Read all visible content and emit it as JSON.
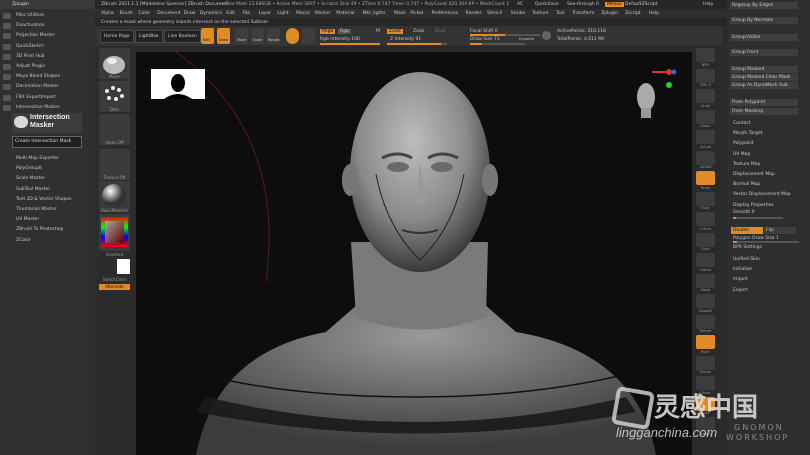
{
  "app": {
    "title": "ZBrush 2021.1.1 [Madeleine Spencer] ZBrush Document"
  },
  "top_info": {
    "status": "• Free Mem 13.686GB • Active Mem 3497 • Scratch Disk 49 • ZTime 0.747 Timer 0.747 • PolyCount 420.364 KP • MeshCount 1",
    "ac": "AC",
    "quicksave": "QuickSave",
    "see_through": "See-through  0",
    "menus_btn": "Menus",
    "default_zscript": "DefaultZScript",
    "help": "Help"
  },
  "menus": [
    "Alpha",
    "Brush",
    "Color",
    "Document",
    "Draw",
    "Dynamics",
    "Edit",
    "File",
    "Layer",
    "Light",
    "Macro",
    "Marker",
    "Material",
    "Mkt_lights",
    "Mask",
    "Picker",
    "Preferences",
    "Render",
    "Stencil",
    "Stroke",
    "Texture",
    "Tool",
    "Transform",
    "Zplugin",
    "Zscript",
    "Help"
  ],
  "tooltip": "Creates a mask where geometry islands intersect on the selected Subtool.",
  "left_panel": {
    "header": "Zplugin",
    "items_top": [
      "Misc Utilities",
      "Deactivation",
      "Projection Master",
      "QuickSketch",
      "3D Print Hub",
      "Adjust Plugin",
      "Maya Blend Shapes",
      "Decimation Master",
      "FBX ExportImport",
      "Intersection Master"
    ],
    "logo_line1": "Intersection",
    "logo_line2": "Masker",
    "create_button": "Create Intersection Mask",
    "items_bottom": [
      "Multi Map Exporter",
      "PolyGroupIt",
      "Scale Master",
      "SubTool Master",
      "Text 3D & Vector Shapes",
      "Thumbnail Master",
      "UV Master",
      "ZBrush To Photoshop",
      "ZColor"
    ]
  },
  "toolbar": {
    "tab_home": "Home Page",
    "tab_lightbox": "LightBox",
    "tab_live": "Live Boolean",
    "edit": "Edit",
    "draw": "Draw",
    "move": "Move",
    "scale": "Scale",
    "rotate": "Rotate",
    "mrgb": "Mrgb",
    "rgb": "Rgb",
    "m": "M",
    "zadd": "Zadd",
    "zsub": "Zsub",
    "zcut": "Zcut",
    "rgb_intensity": "Rgb Intensity 100",
    "z_intensity": "Z Intensity 91",
    "focal_shift": "Focal Shift 0",
    "draw_size": "Draw Size 73",
    "dynamic": "Dynamic",
    "active_points": "ActivePoints: 310,116",
    "total_points": "TotalPoints: 4.611 Mil"
  },
  "shelf": {
    "brush": "Move",
    "stroke": "Dots",
    "alpha": "Alpha Off",
    "texture": "Texture Off",
    "material": "BasicMaterial",
    "gradient": "Gradient",
    "switch_color": "SwitchColor",
    "alternate": "Alternate"
  },
  "right_strip": [
    "BPR",
    "SPix 3",
    "Scroll",
    "Zoom",
    "Actual",
    "AAHalf",
    "Persp",
    "Floor",
    "L.Sym",
    "Gxyz",
    "Frame",
    "Move",
    "ZoomD",
    "Rotate",
    "PolyF",
    "Transp",
    "Ghost",
    "Solo",
    "Xpose"
  ],
  "right_panel": {
    "regroup_by_edges": "Regroup By Edges",
    "group_by_normals": "Group By Normals",
    "group_visible": "GroupVisible",
    "group_front": "Group Front",
    "group_masked": "Group Masked",
    "group_masked_clear": "Group Masked Clear Mask",
    "group_as_dynamesh": "Group As DynaMesh Sub",
    "from_polypaint": "From Polypaint",
    "from_masking": "From Masking",
    "items": [
      "Contact",
      "Morph Target",
      "Polypaint",
      "UV Map",
      "Texture Map",
      "Displacement Map",
      "Normal Map",
      "Vector Displacement Map",
      "Display Properties"
    ],
    "smooth": "Smooth 0",
    "double": "Double",
    "flip": "Flip",
    "polygon_draw_size": "Polygon Draw Size 1",
    "bpr_settings": "BPR Settings",
    "bottom_items": [
      "Unified Skin",
      "Initialize",
      "Import",
      "Export"
    ]
  },
  "watermark": {
    "brand_cn": "灵感中国",
    "site": "lingganchina.com",
    "gnomon": "GNOMON",
    "workshop": "WORKSHOP"
  },
  "colors": {
    "accent": "#e08a2a",
    "bg": "#2a2a2a"
  }
}
